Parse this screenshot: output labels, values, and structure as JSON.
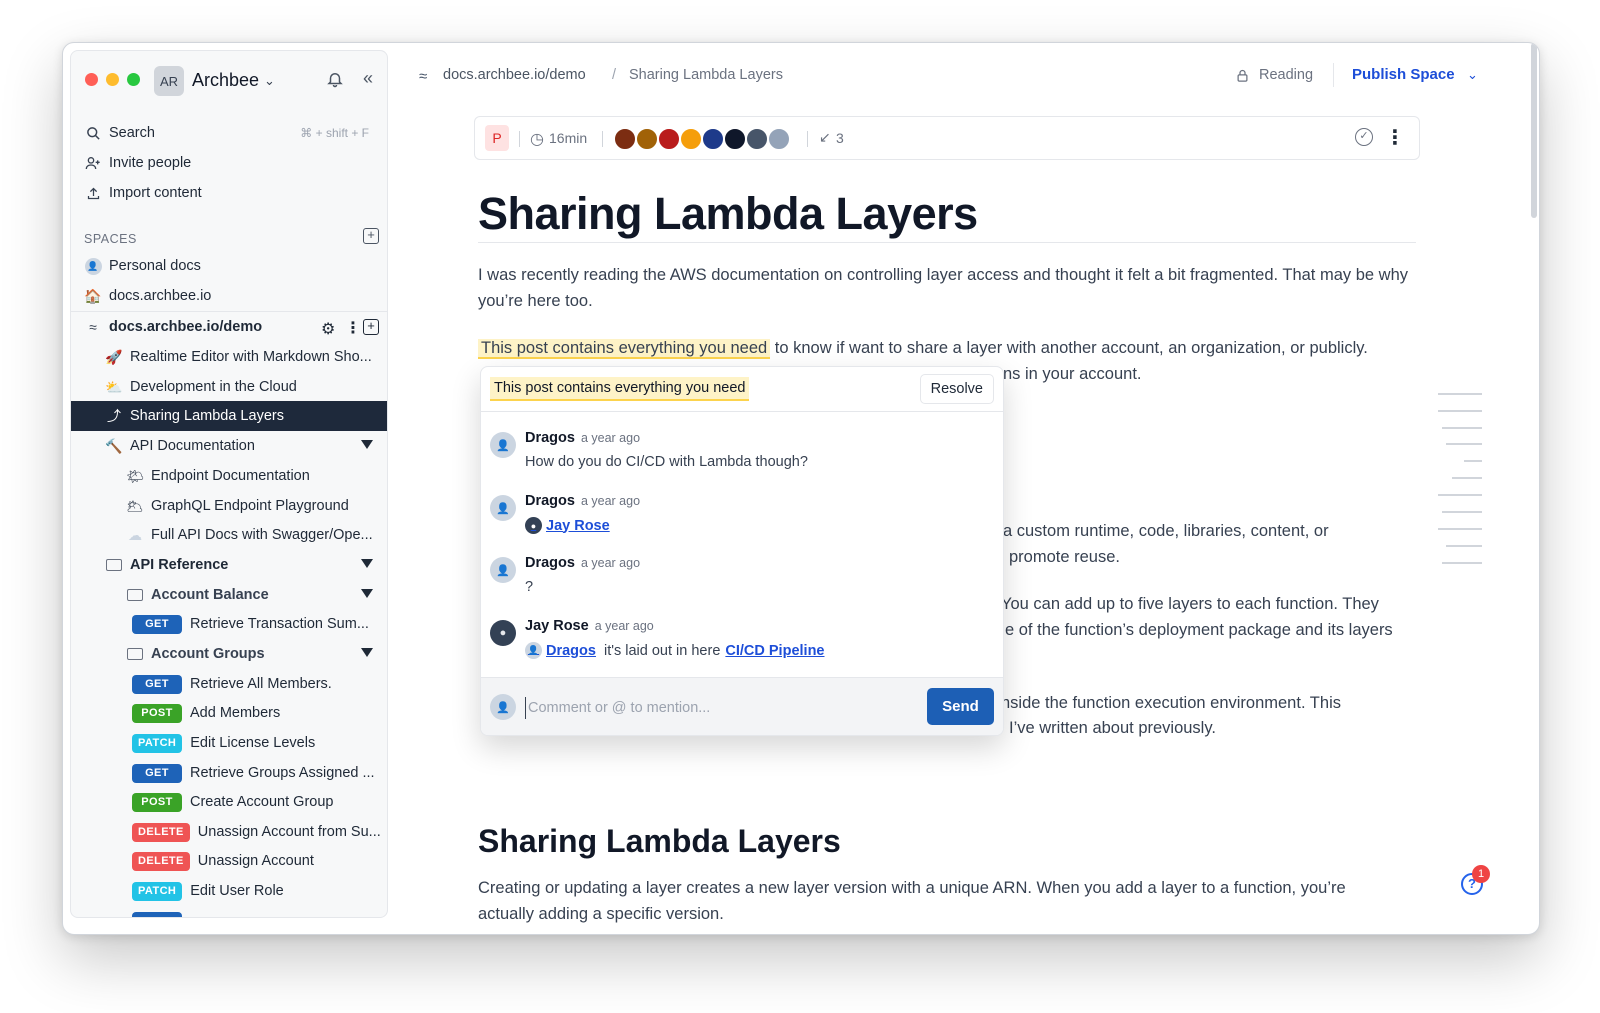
{
  "workspace": {
    "avatar": "AR",
    "name": "Archbee",
    "colors": {
      "red": "#ff5f57",
      "yellow": "#febc2e",
      "green": "#28c840"
    }
  },
  "sidebar": {
    "actions": [
      {
        "label": "Search",
        "shortcut": "⌘ + shift + F",
        "icon": "search-icon"
      },
      {
        "label": "Invite people",
        "icon": "invite-icon"
      },
      {
        "label": "Import content",
        "icon": "import-icon"
      }
    ],
    "spaces_label": "SPACES",
    "spaces": [
      {
        "label": "Personal docs",
        "icon": "person-avatar"
      },
      {
        "label": "docs.archbee.io",
        "icon": "house-emoji"
      }
    ],
    "current_space": "docs.archbee.io/demo",
    "tree": [
      {
        "label": "Realtime Editor with Markdown Sho...",
        "icon": "🚀"
      },
      {
        "label": "Development in the Cloud",
        "icon": "⛅"
      },
      {
        "label": "Sharing Lambda Layers",
        "icon": "⤴"
      },
      {
        "label": "API Documentation",
        "icon": "🔨"
      },
      {
        "label": "Endpoint Documentation",
        "icon": "🌤"
      },
      {
        "label": "GraphQL Endpoint Playground",
        "icon": "🌥"
      },
      {
        "label": "Full API Docs with Swagger/Ope...",
        "icon": "☁"
      },
      {
        "label": "API Reference"
      },
      {
        "label": "Account Balance"
      },
      {
        "method": "GET",
        "label": "Retrieve Transaction Sum..."
      },
      {
        "label": "Account Groups"
      },
      {
        "method": "GET",
        "label": "Retrieve All Members."
      },
      {
        "method": "POST",
        "label": "Add Members"
      },
      {
        "method": "PATCH",
        "label": "Edit License Levels"
      },
      {
        "method": "GET",
        "label": "Retrieve Groups Assigned ..."
      },
      {
        "method": "POST",
        "label": "Create Account Group"
      },
      {
        "method": "DELETE",
        "label": "Unassign Account from Su..."
      },
      {
        "method": "DELETE",
        "label": "Unassign Account"
      },
      {
        "method": "PATCH",
        "label": "Edit User Role"
      }
    ],
    "method_colors": {
      "GET": "#1e63b8",
      "POST": "#3aa327",
      "PATCH": "#22c3e6",
      "DELETE": "#ef5454"
    }
  },
  "topbar": {
    "breadcrumb_space": "docs.archbee.io/demo",
    "breadcrumb_sep": "/",
    "breadcrumb_page": "Sharing Lambda Layers",
    "reading": "Reading",
    "publish": "Publish Space"
  },
  "meta": {
    "badge": "P",
    "read_time": "16min",
    "backlinks": "3",
    "avatar_colors": [
      "#7c2d12",
      "#a16207",
      "#b91c1c",
      "#f59e0b",
      "#1e3a8a",
      "#0f172a",
      "#475569",
      "#94a3b8"
    ]
  },
  "doc": {
    "title": "Sharing Lambda Layers",
    "p1": "I was recently reading the AWS documentation on controlling layer access and thought it felt a bit fragmented. That may be why you’re here too.",
    "p2_highlight": "This post contains everything you need",
    "p2_rest": " to know if want to share a layer with another account, an organization, or publicly.",
    "p2_line2": "ns in your account.",
    "p3_line1": "a custom runtime, code, libraries, content, or",
    "p3_line2": "promote reuse.",
    "p4_line1": "You can add up to five layers to each function. They",
    "p4_line2": "e of the function’s deployment package and its layers",
    "p5_line1": "nside the function execution environment. This",
    "p5_line2": "I’ve written about previously.",
    "h2": "Sharing Lambda Layers",
    "p6_line1": "Creating or updating a layer creates a new layer version with a unique ARN. When you add a layer to a function, you’re",
    "p6_line2": "actually adding a specific version."
  },
  "comments": {
    "quote": "This post contains everything you need",
    "resolve": "Resolve",
    "thread": [
      {
        "author": "Dragos",
        "time": "a year ago",
        "body": "How do you do CI/CD with Lambda though?"
      },
      {
        "author": "Dragos",
        "time": "a year ago",
        "mention": "Jay Rose"
      },
      {
        "author": "Dragos",
        "time": "a year ago",
        "body": "?"
      },
      {
        "author": "Jay Rose",
        "time": "a year ago",
        "mention": "Dragos",
        "body": "it's laid out in here",
        "link": "CI/CD Pipeline"
      }
    ],
    "placeholder": "Comment or @ to mention...",
    "send": "Send"
  },
  "help": {
    "badge": "1",
    "icon": "?"
  }
}
